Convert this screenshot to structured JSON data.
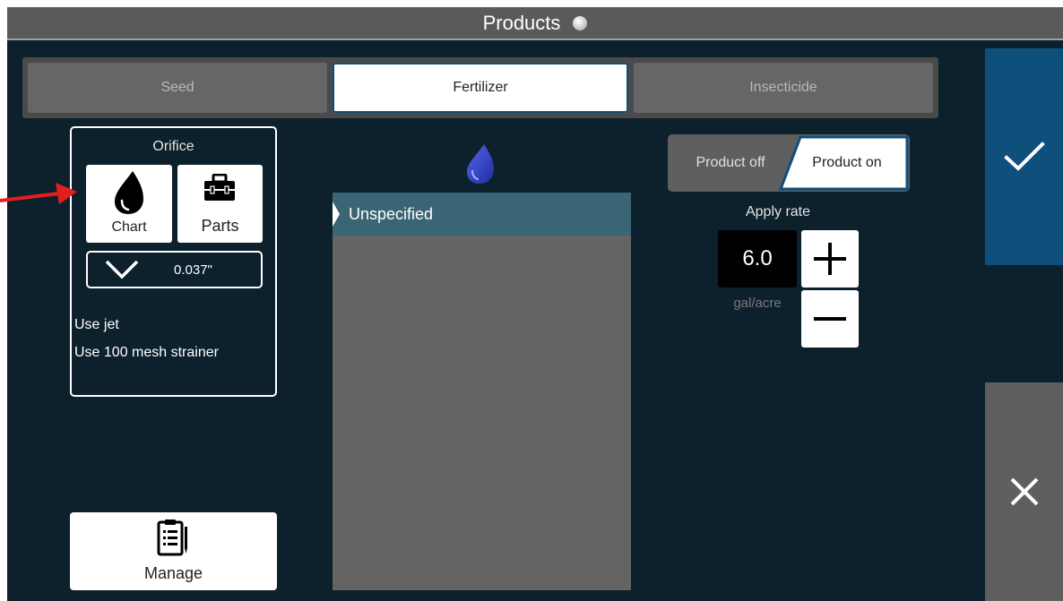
{
  "header": {
    "title": "Products"
  },
  "tabs": [
    {
      "label": "Seed",
      "selected": false
    },
    {
      "label": "Fertilizer",
      "selected": true
    },
    {
      "label": "Insecticide",
      "selected": false
    }
  ],
  "orifice": {
    "title": "Orifice",
    "chart_label": "Chart",
    "parts_label": "Parts",
    "selected_size": "0.037\"",
    "notes": [
      "Use jet",
      "Use 100 mesh strainer"
    ]
  },
  "manage": {
    "label": "Manage"
  },
  "product_list": {
    "items": [
      {
        "label": "Unspecified",
        "selected": true
      }
    ]
  },
  "product_toggle": {
    "off_label": "Product off",
    "on_label": "Product on",
    "state": "on"
  },
  "apply_rate": {
    "label": "Apply rate",
    "value": "6.0",
    "unit": "gal/acre"
  },
  "icons": {
    "status": "status-dot-icon",
    "chart": "drop-icon",
    "parts": "toolbox-icon",
    "dropdown": "chevron-down-icon",
    "manage": "clipboard-icon",
    "product": "drop-icon",
    "confirm": "check-icon",
    "cancel": "close-icon",
    "increase": "plus-icon",
    "decrease": "minus-icon",
    "annotation": "red-arrow-icon"
  },
  "colors": {
    "background": "#0c212c",
    "accent": "#0e4f7b",
    "selected_row": "#3a6575",
    "product_drop": "#2e3ec4",
    "annotation": "#e41d1d"
  }
}
